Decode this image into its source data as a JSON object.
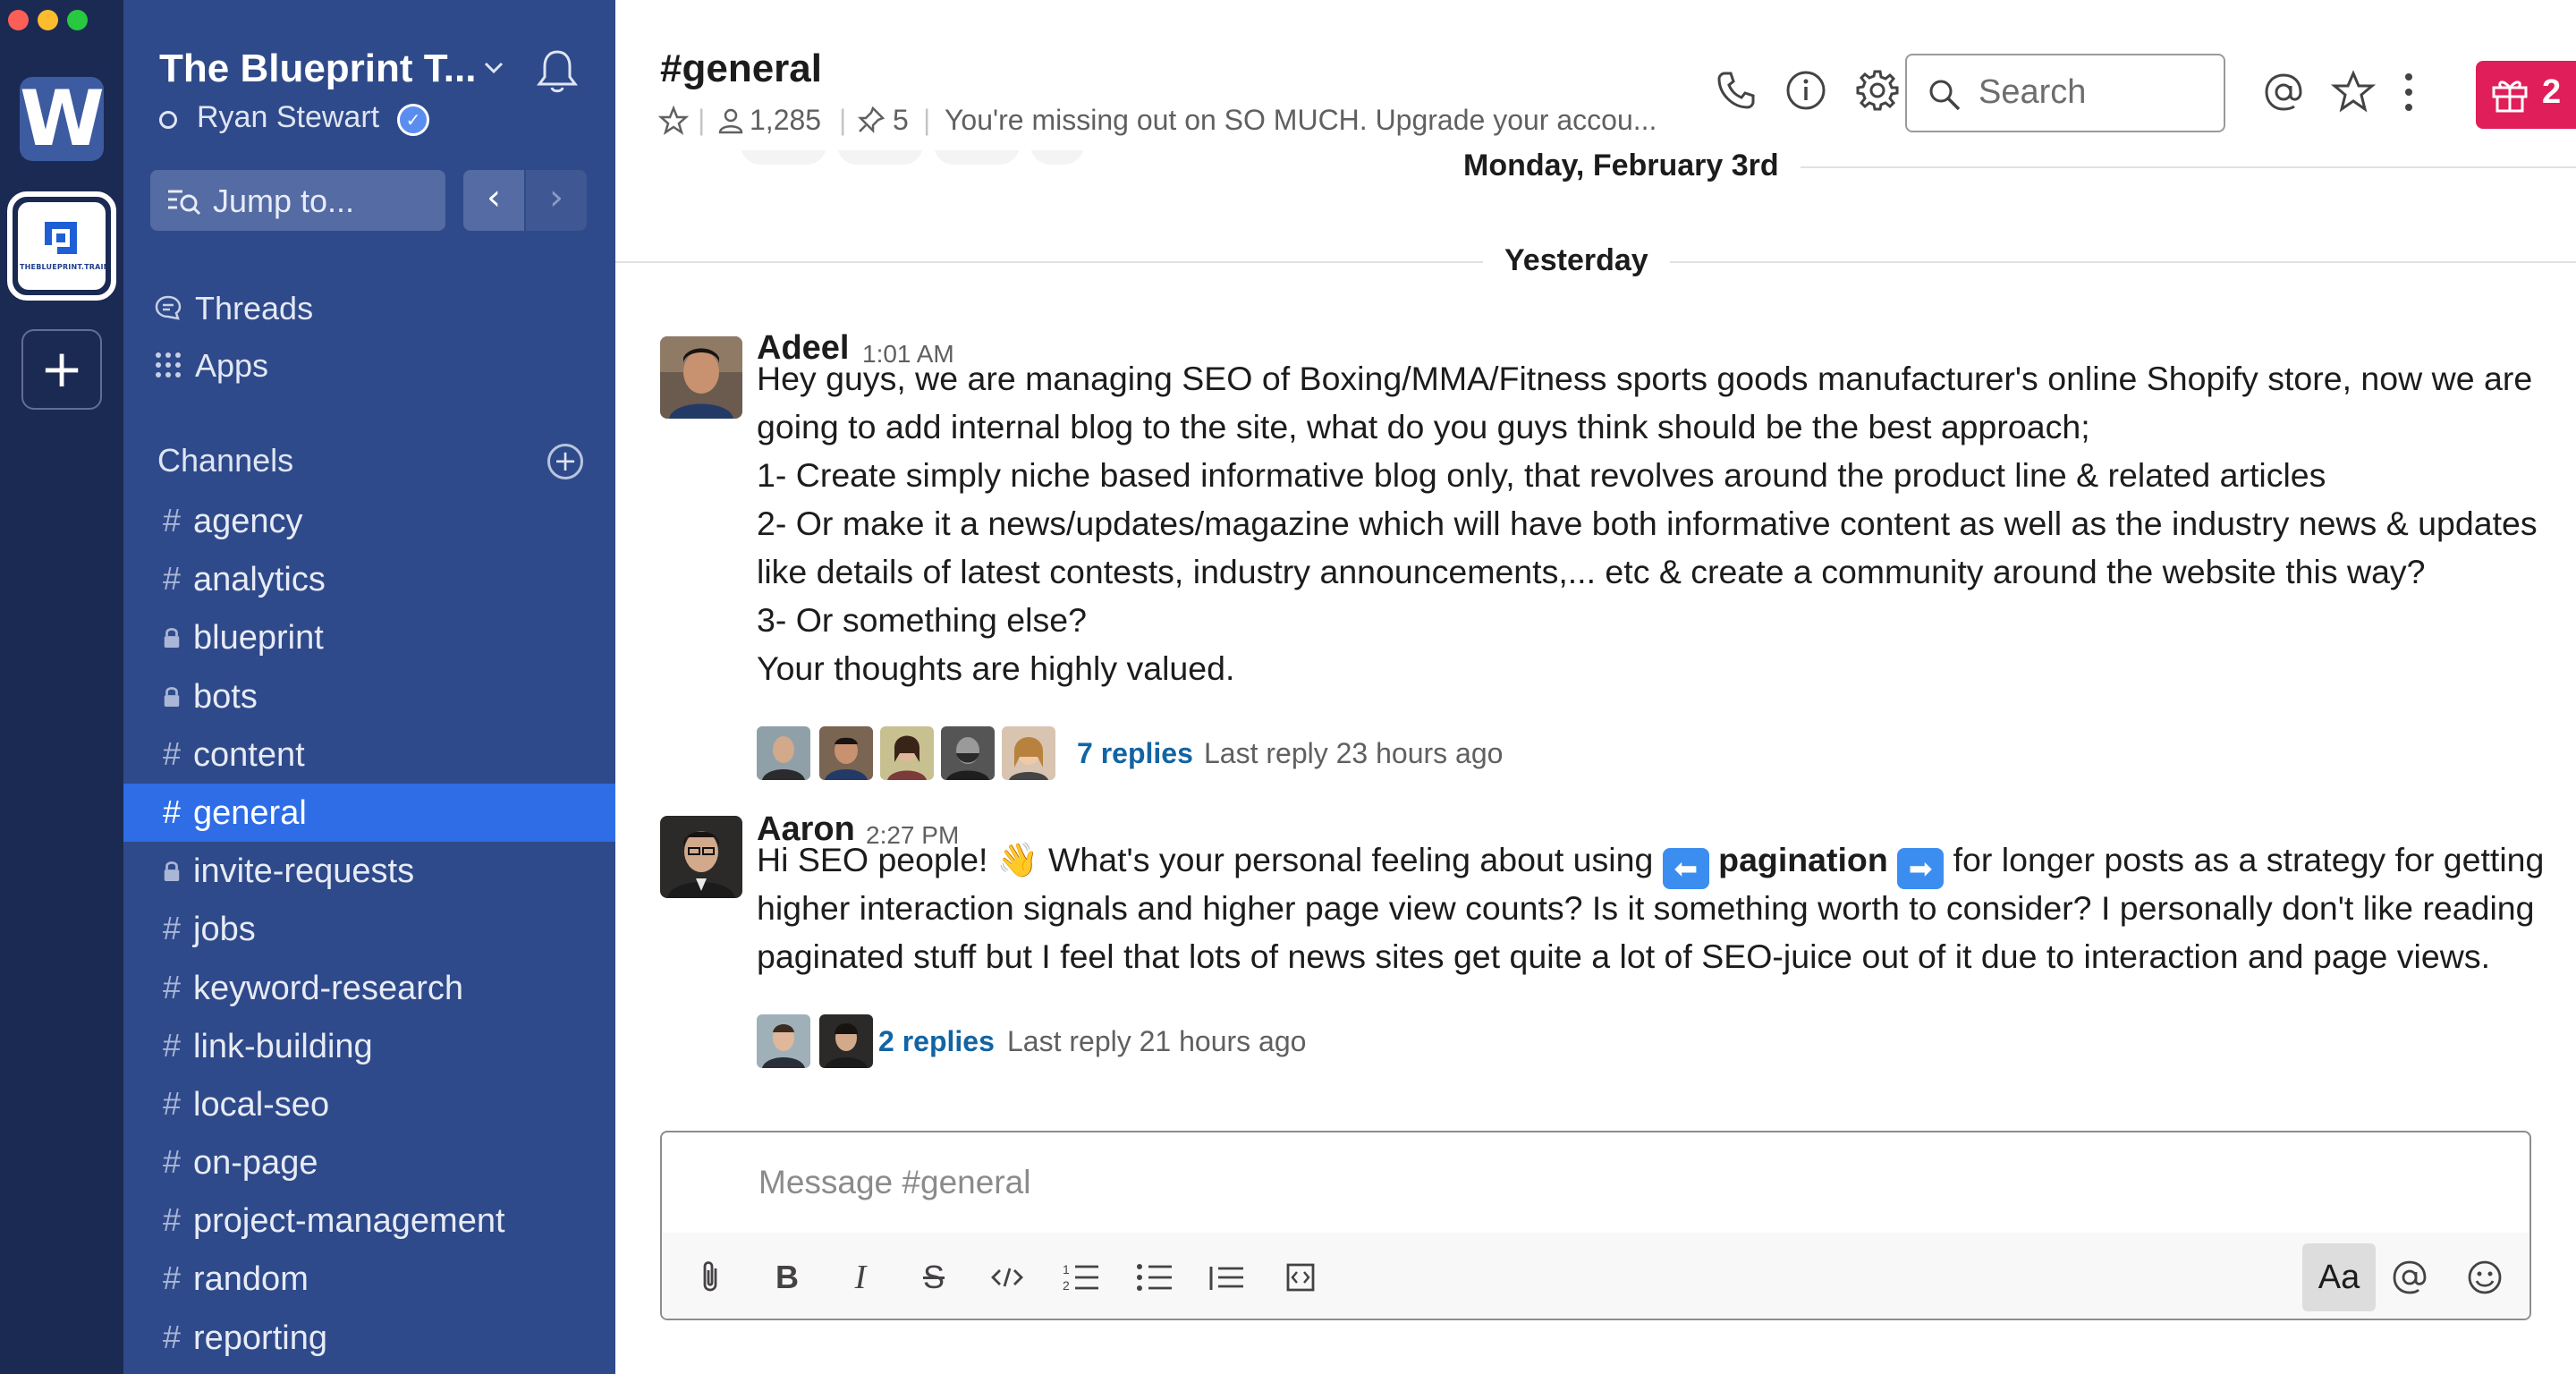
{
  "window": {
    "traffic_lights": [
      "#fd5f57",
      "#fdbc2e",
      "#28c840"
    ]
  },
  "rail": {
    "workspaces": [
      {
        "id": "w",
        "letter": "W"
      },
      {
        "id": "blueprint",
        "logo_text": "THEBLUEPRINT.TRAINING"
      }
    ],
    "add_label": "+"
  },
  "sidebar": {
    "team_name": "The Blueprint T...",
    "user_name": "Ryan Stewart",
    "jump_to": "Jump to...",
    "nav": [
      {
        "label": "Threads",
        "icon": "threads-icon"
      },
      {
        "label": "Apps",
        "icon": "apps-grid-icon"
      }
    ],
    "channels_header": "Channels",
    "channels": [
      {
        "name": "agency",
        "private": false,
        "active": false
      },
      {
        "name": "analytics",
        "private": false,
        "active": false
      },
      {
        "name": "blueprint",
        "private": true,
        "active": false
      },
      {
        "name": "bots",
        "private": true,
        "active": false
      },
      {
        "name": "content",
        "private": false,
        "active": false
      },
      {
        "name": "general",
        "private": false,
        "active": true
      },
      {
        "name": "invite-requests",
        "private": true,
        "active": false
      },
      {
        "name": "jobs",
        "private": false,
        "active": false
      },
      {
        "name": "keyword-research",
        "private": false,
        "active": false
      },
      {
        "name": "link-building",
        "private": false,
        "active": false
      },
      {
        "name": "local-seo",
        "private": false,
        "active": false
      },
      {
        "name": "on-page",
        "private": false,
        "active": false
      },
      {
        "name": "project-management",
        "private": false,
        "active": false
      },
      {
        "name": "random",
        "private": false,
        "active": false
      },
      {
        "name": "reporting",
        "private": false,
        "active": false
      }
    ]
  },
  "header": {
    "channel": "#general",
    "members": "1,285",
    "pins": "5",
    "topic": "You're missing out on SO MUCH. Upgrade your accou...",
    "search_placeholder": "Search",
    "gift_count": "2"
  },
  "messages": {
    "dividers": {
      "top": "Monday, February 3rd",
      "yesterday": "Yesterday"
    },
    "items": [
      {
        "sender": "Adeel",
        "time": "1:01 AM",
        "lines": [
          "Hey guys, we are managing SEO of Boxing/MMA/Fitness sports goods manufacturer's online Shopify store, now we are",
          "going to add internal blog to the site, what do you guys think should be the best approach;",
          "1- Create simply niche based informative blog only, that revolves around the product line & related articles",
          "2- Or make it a news/updates/magazine which will have both informative content as well as the industry news & updates",
          "like details of latest contests, industry announcements,... etc & create a community around the website this way?",
          "3- Or something else?",
          "Your thoughts are highly valued."
        ],
        "replies": "7 replies",
        "last_reply": "Last reply 23 hours ago"
      },
      {
        "sender": "Aaron",
        "time": "2:27 PM",
        "line1_a": "Hi SEO people! ",
        "wave_emoji": "👋",
        "line1_b": " What's your personal feeling about using ",
        "emoji_left": "⬅",
        "line1_bold": "pagination",
        "emoji_right": "➡",
        "line1_c": " for longer posts as a strategy for getting",
        "lines_rest": [
          "higher interaction signals and higher page view counts? Is it something worth to consider? I personally don't like reading",
          "paginated stuff but I feel that lots of news sites get quite a lot of SEO-juice out of it due to interaction and page views."
        ],
        "replies": "2 replies",
        "last_reply": "Last reply 21 hours ago"
      }
    ]
  },
  "composer": {
    "placeholder": "Message #general",
    "format_label": "Aa"
  },
  "colors": {
    "rail": "#1b2a53",
    "sidebar": "#2f4a8a",
    "active_channel": "#2e6de6",
    "link": "#1264a3",
    "gift": "#e01e5a"
  }
}
